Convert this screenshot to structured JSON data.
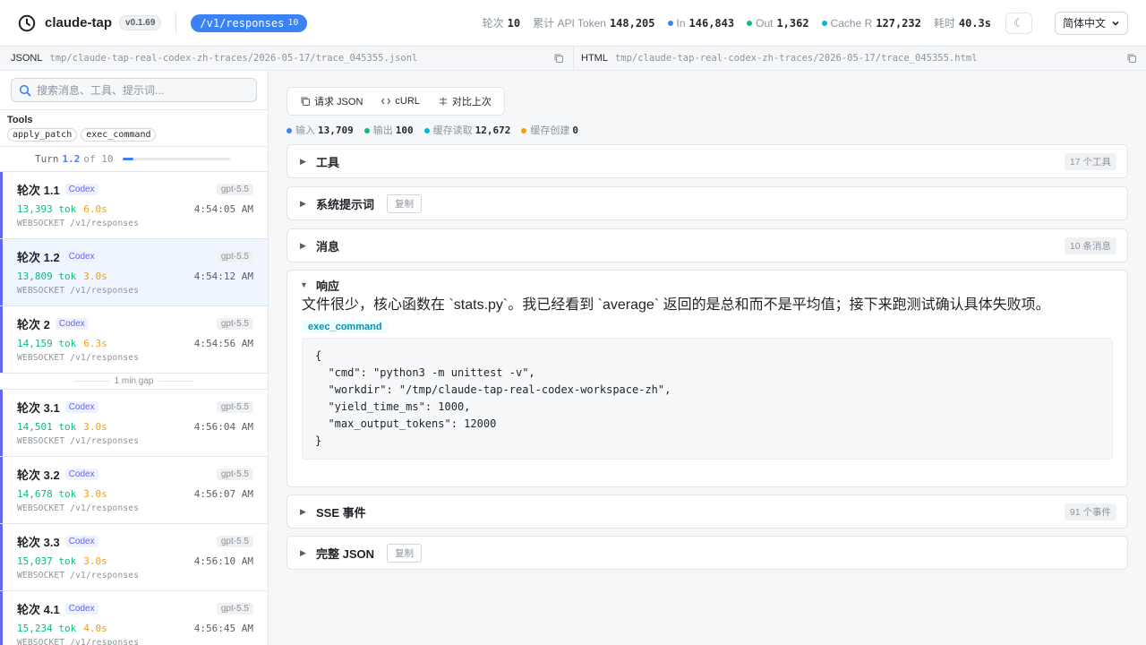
{
  "header": {
    "app_name": "claude-tap",
    "version": "v0.1.69",
    "endpoint": "/v1/responses",
    "endpoint_count": "10",
    "stats": {
      "turns_label": "轮次",
      "turns_value": "10",
      "tokens_label": "累计 API Token",
      "tokens_value": "148,205",
      "in_label": "In",
      "in_value": "146,843",
      "out_label": "Out",
      "out_value": "1,362",
      "cache_label": "Cache R",
      "cache_value": "127,232",
      "elapsed_label": "耗时",
      "elapsed_value": "40.3s"
    },
    "theme_icon": "☾",
    "language": "简体中文"
  },
  "colors": {
    "accent": "#3b82f6",
    "in": "#3b82f6",
    "out": "#10b981",
    "cache": "#06b6d4",
    "cache_create": "#f59e0b"
  },
  "paths": {
    "jsonl_label": "JSONL",
    "jsonl_value": "tmp/claude-tap-real-codex-zh-traces/2026-05-17/trace_045355.jsonl",
    "html_label": "HTML",
    "html_value": "tmp/claude-tap-real-codex-zh-traces/2026-05-17/trace_045355.html"
  },
  "sidebar": {
    "search_placeholder": "搜索消息、工具、提示词...",
    "tools_title": "Tools",
    "tools": [
      "apply_patch",
      "exec_command"
    ],
    "turn_label": "Turn",
    "turn_current": "1.2",
    "turn_of": "of 10",
    "turn_progress": 0.1,
    "gap_label": "1 min gap",
    "turns": [
      {
        "title": "轮次 1.1",
        "badge": "Codex",
        "model": "gpt-5.5",
        "tokens": "13,393 tok",
        "time": "6.0s",
        "clock": "4:54:05 AM",
        "transport": "WEBSOCKET /v1/responses"
      },
      {
        "title": "轮次 1.2",
        "badge": "Codex",
        "model": "gpt-5.5",
        "tokens": "13,809 tok",
        "time": "3.0s",
        "clock": "4:54:12 AM",
        "transport": "WEBSOCKET /v1/responses"
      },
      {
        "title": "轮次 2",
        "badge": "Codex",
        "model": "gpt-5.5",
        "tokens": "14,159 tok",
        "time": "6.3s",
        "clock": "4:54:56 AM",
        "transport": "WEBSOCKET /v1/responses"
      },
      {
        "title": "轮次 3.1",
        "badge": "Codex",
        "model": "gpt-5.5",
        "tokens": "14,501 tok",
        "time": "3.0s",
        "clock": "4:56:04 AM",
        "transport": "WEBSOCKET /v1/responses"
      },
      {
        "title": "轮次 3.2",
        "badge": "Codex",
        "model": "gpt-5.5",
        "tokens": "14,678 tok",
        "time": "3.0s",
        "clock": "4:56:07 AM",
        "transport": "WEBSOCKET /v1/responses"
      },
      {
        "title": "轮次 3.3",
        "badge": "Codex",
        "model": "gpt-5.5",
        "tokens": "15,037 tok",
        "time": "3.0s",
        "clock": "4:56:10 AM",
        "transport": "WEBSOCKET /v1/responses"
      },
      {
        "title": "轮次 4.1",
        "badge": "Codex",
        "model": "gpt-5.5",
        "tokens": "15,234 tok",
        "time": "4.0s",
        "clock": "4:56:45 AM",
        "transport": "WEBSOCKET /v1/responses"
      }
    ]
  },
  "main": {
    "toolbar": {
      "request_json": "请求 JSON",
      "curl": "cURL",
      "diff": "对比上次"
    },
    "usage": {
      "input_label": "输入",
      "input_value": "13,709",
      "output_label": "输出",
      "output_value": "100",
      "cache_read_label": "缓存读取",
      "cache_read_value": "12,672",
      "cache_create_label": "缓存创建",
      "cache_create_value": "0"
    },
    "sections": {
      "tools": {
        "title": "工具",
        "count": "17 个工具"
      },
      "system": {
        "title": "系统提示词",
        "copy": "复制"
      },
      "messages": {
        "title": "消息",
        "count": "10 条消息"
      },
      "response": {
        "title": "响应",
        "text": "文件很少，核心函数在 `stats.py`。我已经看到 `average` 返回的是总和而不是平均值；接下来跑测试确认具体失败项。",
        "tool_name": "exec_command",
        "code": "{\n  \"cmd\": \"python3 -m unittest -v\",\n  \"workdir\": \"/tmp/claude-tap-real-codex-workspace-zh\",\n  \"yield_time_ms\": 1000,\n  \"max_output_tokens\": 12000\n}"
      },
      "sse": {
        "title": "SSE 事件",
        "count": "91 个事件"
      },
      "full_json": {
        "title": "完整 JSON",
        "copy": "复制"
      }
    }
  }
}
